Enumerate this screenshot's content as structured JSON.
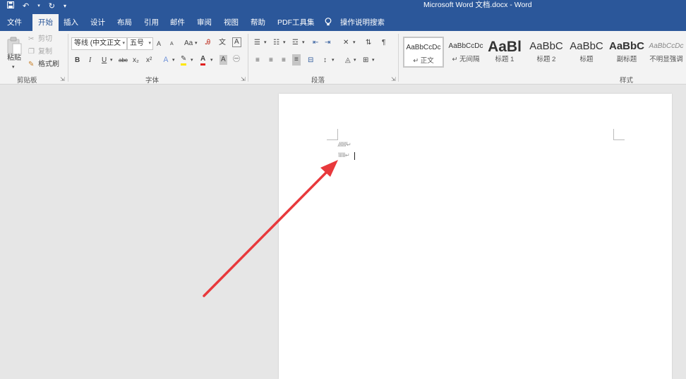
{
  "titlebar": {
    "doc_title": "Microsoft Word 文档.docx  -  Word",
    "save_icon": "save-icon",
    "undo_icon": "undo-icon",
    "redo_icon": "redo-icon",
    "customize_icon": "customize-qat-icon"
  },
  "tabs": [
    "文件",
    "开始",
    "插入",
    "设计",
    "布局",
    "引用",
    "邮件",
    "审阅",
    "视图",
    "帮助",
    "PDF工具集"
  ],
  "active_tab": "开始",
  "search": {
    "label": "操作说明搜索",
    "icon": "lightbulb-icon"
  },
  "clipboard": {
    "paste": "粘贴",
    "cut": "剪切",
    "copy": "复制",
    "format_painter": "格式刷",
    "label": "剪贴板"
  },
  "font": {
    "font_name": "等线 (中文正文",
    "font_size": "五号",
    "label": "字体",
    "grow": "A",
    "shrink": "A",
    "change_case": "Aa",
    "bold": "B",
    "italic": "I",
    "underline": "U",
    "strike": "abc",
    "subscript": "x₂",
    "superscript": "x²"
  },
  "paragraph": {
    "label": "段落"
  },
  "styles": {
    "label": "样式",
    "items": [
      {
        "sample": "AaBbCcDc",
        "name": "↵ 正文"
      },
      {
        "sample": "AaBbCcDc",
        "name": "↵ 无间隔"
      },
      {
        "sample": "AaBl",
        "name": "标题 1"
      },
      {
        "sample": "AaBbC",
        "name": "标题 2"
      },
      {
        "sample": "AaBbC",
        "name": "标题"
      },
      {
        "sample": "AaBbC",
        "name": "副标题"
      },
      {
        "sample": "AaBbCcDc",
        "name": "不明显强调"
      }
    ]
  },
  "document": {
    "line1": "//////",
    "line2": "\\\\\\\\\\",
    "para_mark": "↵"
  },
  "colors": {
    "word_blue": "#2b579a",
    "ribbon_bg": "#f3f3f3",
    "canvas_bg": "#e6e6e6",
    "annotation_arrow": "#e8393c"
  }
}
